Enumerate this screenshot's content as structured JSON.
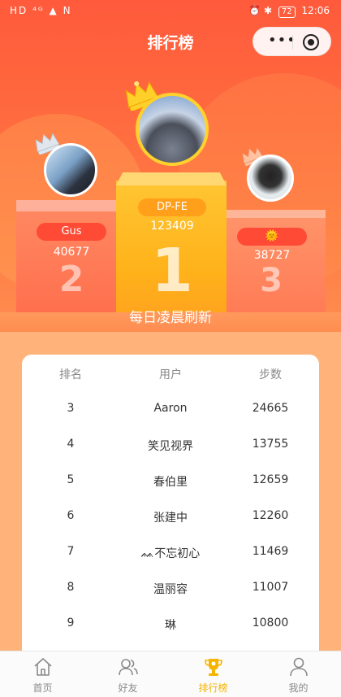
{
  "status": {
    "left_icons": "HD ⁴ᴳ ▲ N",
    "right_icons": "⏰ ✱",
    "battery": "72",
    "time": "12:06"
  },
  "header": {
    "title": "排行榜",
    "capsule_more": "•••"
  },
  "podium": {
    "first": {
      "name": "DP-FE",
      "steps": "123409",
      "rank": "1"
    },
    "second": {
      "name": "Gus",
      "steps": "40677",
      "rank": "2"
    },
    "third": {
      "name": "🌞",
      "steps": "38727",
      "rank": "3"
    }
  },
  "refresh_text": "每日凌晨刷新",
  "table": {
    "headers": [
      "排名",
      "用户",
      "步数"
    ],
    "rows": [
      {
        "rank": "3",
        "user": "Aaron",
        "steps": "24665"
      },
      {
        "rank": "4",
        "user": "笑见视界",
        "steps": "13755"
      },
      {
        "rank": "5",
        "user": "春伯里",
        "steps": "12659"
      },
      {
        "rank": "6",
        "user": "张建中",
        "steps": "12260"
      },
      {
        "rank": "7",
        "user": "ᨐ不忘初心",
        "steps": "11469"
      },
      {
        "rank": "8",
        "user": "温丽容",
        "steps": "11007"
      },
      {
        "rank": "9",
        "user": "琳",
        "steps": "10800"
      }
    ]
  },
  "tabs": [
    {
      "label": "首页",
      "icon": "home-icon",
      "active": false
    },
    {
      "label": "好友",
      "icon": "friends-icon",
      "active": false
    },
    {
      "label": "排行榜",
      "icon": "trophy-icon",
      "active": true
    },
    {
      "label": "我的",
      "icon": "profile-icon",
      "active": false
    }
  ],
  "colors": {
    "accent": "#f4b400",
    "hero_top": "#ff5a3c",
    "pill_red": "#ff4a36",
    "gold": "#ffc633"
  }
}
